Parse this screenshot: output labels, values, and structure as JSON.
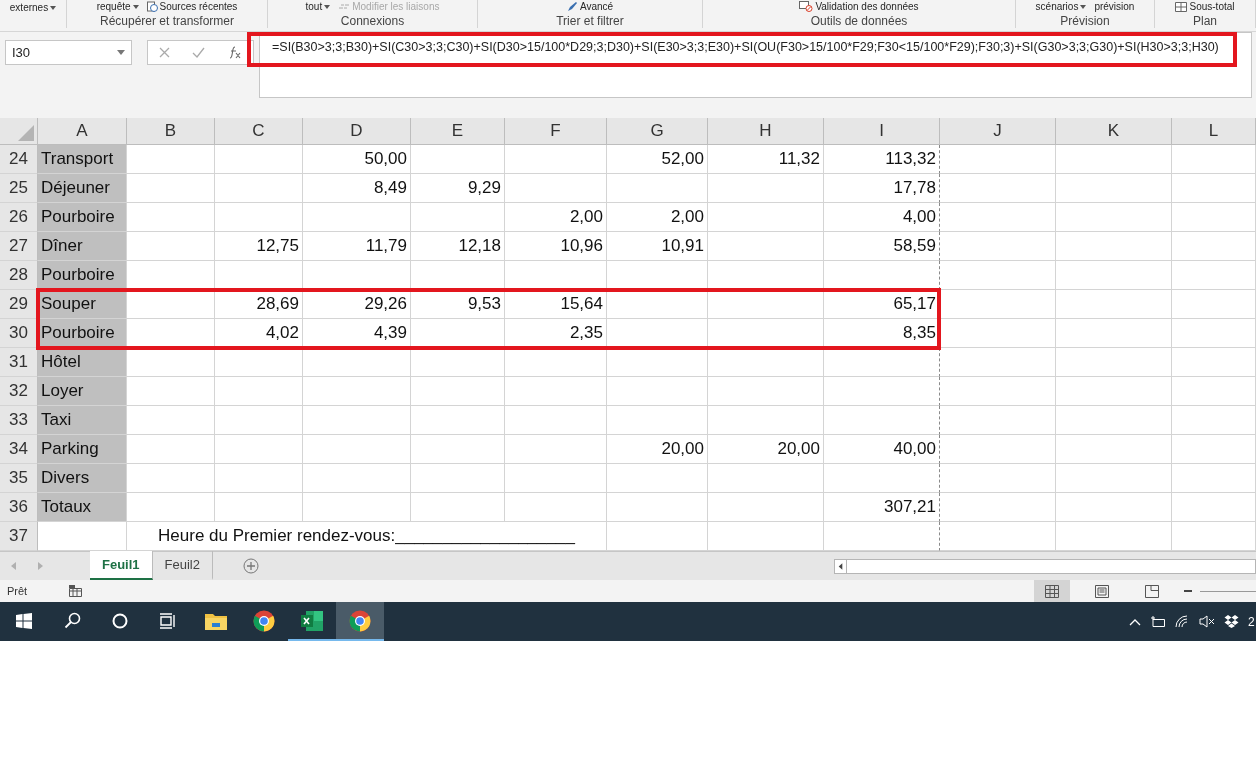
{
  "ribbon": {
    "groups": [
      {
        "items": [
          {
            "label": "externes",
            "kind": "dropdown"
          }
        ]
      },
      {
        "title": "Récupérer et transformer",
        "items": [
          {
            "label": "requête",
            "kind": "dropdown"
          },
          {
            "label": "Sources récentes",
            "kind": "clock"
          }
        ]
      },
      {
        "title": "Connexions",
        "items": [
          {
            "label": "tout",
            "kind": "dropdown"
          },
          {
            "label": "Modifier les liaisons",
            "kind": "link",
            "disabled": true
          }
        ]
      },
      {
        "title": "Trier et filtrer",
        "items": [
          {
            "label": "Avancé",
            "kind": "filter"
          }
        ]
      },
      {
        "title": "Outils de données",
        "items": [
          {
            "label": "Validation des données",
            "kind": "validation"
          }
        ]
      },
      {
        "title": "Prévision",
        "items": [
          {
            "label": "scénarios",
            "kind": "dropdown"
          },
          {
            "label": "prévision",
            "kind": "plain"
          }
        ]
      },
      {
        "title": "Plan",
        "items": [
          {
            "label": "Sous-total",
            "kind": "table"
          }
        ]
      }
    ]
  },
  "formula_bar": {
    "name_box": "I30",
    "formula": "=SI(B30>3;3;B30)+SI(C30>3;3;C30)+SI(D30>15/100*D29;3;D30)+SI(E30>3;3;E30)+SI(OU(F30>15/100*F29;F30<15/100*F29);F30;3)+SI(G30>3;3;G30)+SI(H30>3;3;H30)",
    "highlighted": true
  },
  "columns": [
    "A",
    "B",
    "C",
    "D",
    "E",
    "F",
    "G",
    "H",
    "I",
    "J",
    "K",
    "L"
  ],
  "rows": [
    {
      "number": "24",
      "label": "Transport",
      "highlighted": false,
      "cells": {
        "D": "50,00",
        "G": "52,00",
        "H": "11,32",
        "I": "113,32"
      }
    },
    {
      "number": "25",
      "label": "Déjeuner",
      "highlighted": false,
      "cells": {
        "D": "8,49",
        "E": "9,29",
        "I": "17,78"
      }
    },
    {
      "number": "26",
      "label": "Pourboire",
      "highlighted": false,
      "cells": {
        "F": "2,00",
        "G": "2,00",
        "I": "4,00"
      }
    },
    {
      "number": "27",
      "label": "Dîner",
      "highlighted": false,
      "cells": {
        "C": "12,75",
        "D": "11,79",
        "E": "12,18",
        "F": "10,96",
        "G": "10,91",
        "I": "58,59"
      }
    },
    {
      "number": "28",
      "label": "Pourboire",
      "highlighted": false
    },
    {
      "number": "29",
      "label": "Souper",
      "highlighted": true,
      "cells": {
        "C": "28,69",
        "D": "29,26",
        "E": "9,53",
        "F": "15,64",
        "I": "65,17"
      }
    },
    {
      "number": "30",
      "label": "Pourboire",
      "highlighted": true,
      "cells": {
        "C": "4,02",
        "D": "4,39",
        "F": "2,35",
        "I": "8,35"
      }
    },
    {
      "number": "31",
      "label": "Hôtel",
      "highlighted": false
    },
    {
      "number": "32",
      "label": "Loyer",
      "highlighted": false
    },
    {
      "number": "33",
      "label": "Taxi",
      "highlighted": false
    },
    {
      "number": "34",
      "label": "Parking",
      "highlighted": false,
      "cells": {
        "G": "20,00",
        "H": "20,00",
        "I": "40,00"
      }
    },
    {
      "number": "35",
      "label": "Divers",
      "highlighted": false
    },
    {
      "number": "36",
      "label": "Totaux",
      "highlighted": false,
      "cells": {
        "I": "307,21"
      }
    },
    {
      "number": "37",
      "highlighted": false,
      "note": "Heure du Premier rendez-vous:___________________"
    }
  ],
  "sheet_tabs": [
    {
      "label": "Feuil1",
      "selected": true
    },
    {
      "label": "Feuil2",
      "selected": false
    }
  ],
  "status_bar": {
    "status": "Prêt",
    "views": [
      {
        "kind": "normal",
        "selected": true
      },
      {
        "kind": "layout",
        "selected": false
      },
      {
        "kind": "pagebreak",
        "selected": false
      }
    ]
  },
  "taskbar": {
    "apps": [
      {
        "kind": "windows",
        "running": false,
        "active": false
      },
      {
        "kind": "search",
        "running": false,
        "active": false
      },
      {
        "kind": "cortana",
        "running": false,
        "active": false
      },
      {
        "kind": "taskview",
        "running": false,
        "active": false
      },
      {
        "kind": "explorer",
        "running": false,
        "active": false
      },
      {
        "kind": "chrome",
        "running": false,
        "active": false
      },
      {
        "kind": "excel",
        "running": true,
        "active": false
      },
      {
        "kind": "chrome",
        "running": true,
        "active": true
      }
    ],
    "clock": "2"
  }
}
